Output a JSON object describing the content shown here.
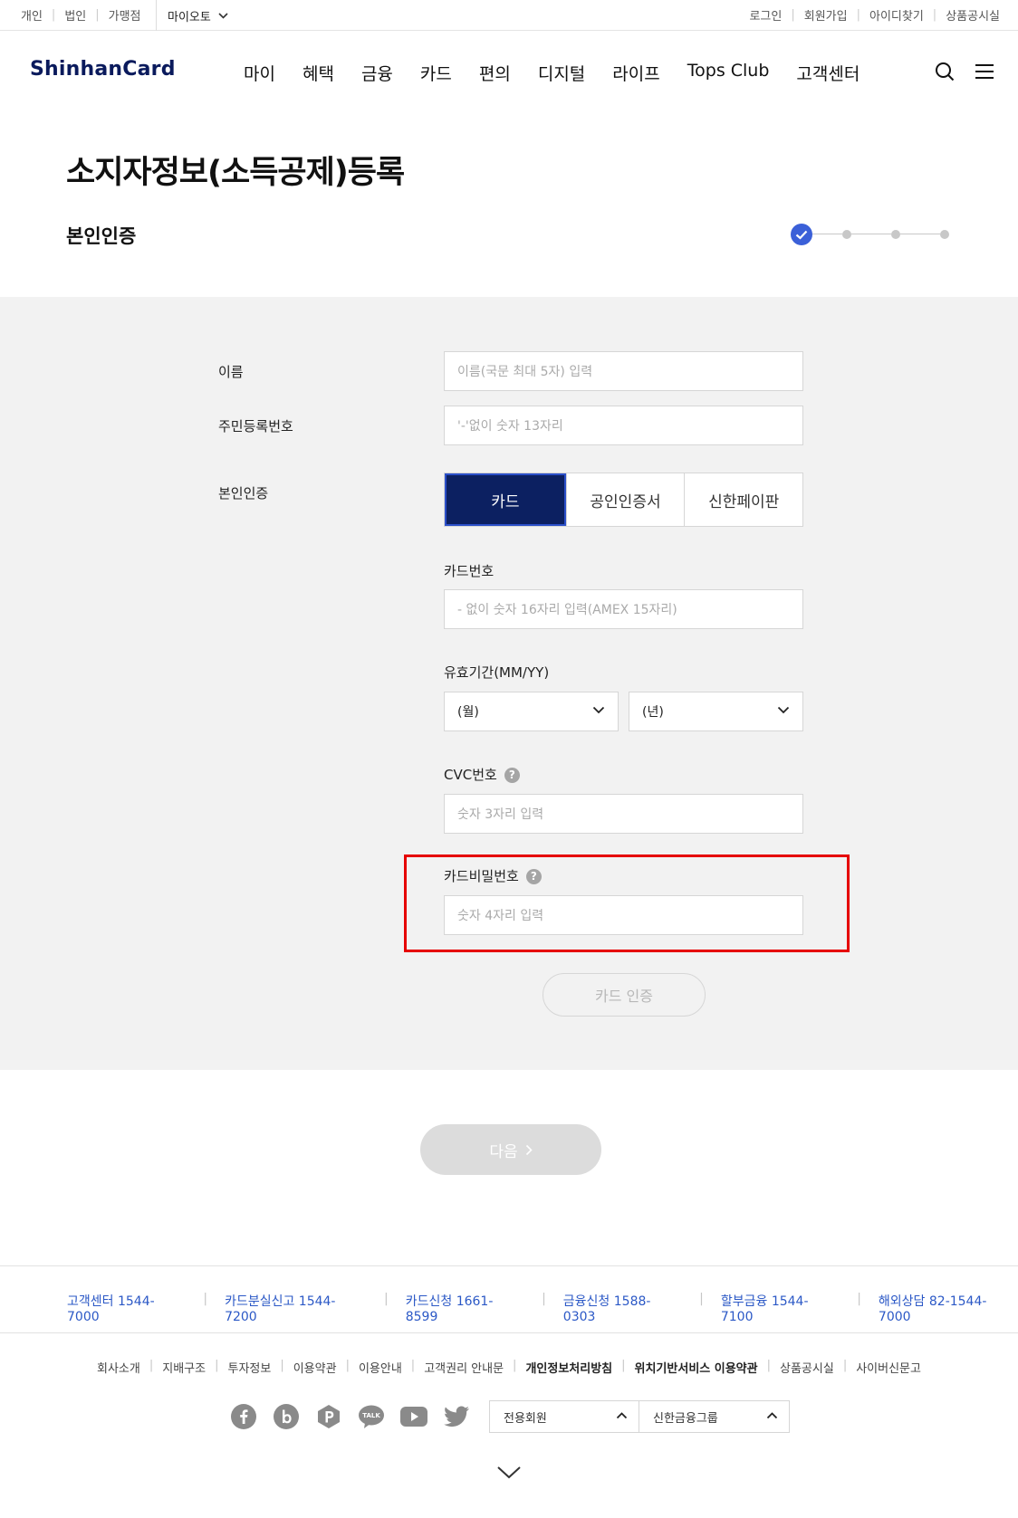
{
  "topbar": {
    "left_links": [
      "개인",
      "법인",
      "가맹점"
    ],
    "myauto_label": "마이오토",
    "right_links": [
      "로그인",
      "회원가입",
      "아이디찾기",
      "상품공시실"
    ]
  },
  "header": {
    "logo_text": "ShinhanCard",
    "nav": [
      "마이",
      "혜택",
      "금융",
      "카드",
      "편의",
      "디지털",
      "라이프",
      "Tops Club",
      "고객센터"
    ]
  },
  "page": {
    "title": "소지자정보(소득공제)등록",
    "section_title": "본인인증",
    "steps_total": 4,
    "steps_done": 1
  },
  "form": {
    "name_label": "이름",
    "name_placeholder": "이름(국문 최대 5자) 입력",
    "rrn_label": "주민등록번호",
    "rrn_placeholder": "'-'없이 숫자 13자리",
    "auth_label": "본인인증",
    "auth_tabs": [
      "카드",
      "공인인증서",
      "신한페이판"
    ],
    "auth_selected": "카드",
    "card_number_label": "카드번호",
    "card_number_placeholder": "- 없이 숫자 16자리 입력(AMEX 15자리)",
    "expiry_label": "유효기간(MM/YY)",
    "expiry_month": "(월)",
    "expiry_year": "(년)",
    "cvc_label": "CVC번호",
    "cvc_placeholder": "숫자 3자리 입력",
    "pin_label": "카드비밀번호",
    "pin_placeholder": "숫자 4자리 입력",
    "help_glyph": "?",
    "card_auth_button": "카드 인증"
  },
  "next_button": "다음",
  "footer": {
    "contacts": [
      "고객센터 1544-7000",
      "카드분실신고 1544-7200",
      "카드신청 1661-8599",
      "금융신청 1588-0303",
      "할부금융 1544-7100",
      "해외상담 82-1544-7000"
    ],
    "links": [
      "회사소개",
      "지배구조",
      "투자정보",
      "이용약관",
      "이용안내",
      "고객권리 안내문",
      "개인정보처리방침",
      "위치기반서비스 이용약관",
      "상품공시실",
      "사이버신문고"
    ],
    "sns_icons": [
      "facebook-icon",
      "blog-icon",
      "post-icon",
      "kakaotalk-icon",
      "youtube-icon",
      "twitter-icon"
    ],
    "select_members": "전용회원",
    "select_group": "신한금융그룹"
  },
  "colors": {
    "brand_navy": "#0c2061",
    "accent_blue": "#3b60d8",
    "contact_blue": "#2b58c6",
    "highlight_red": "#e60000"
  }
}
